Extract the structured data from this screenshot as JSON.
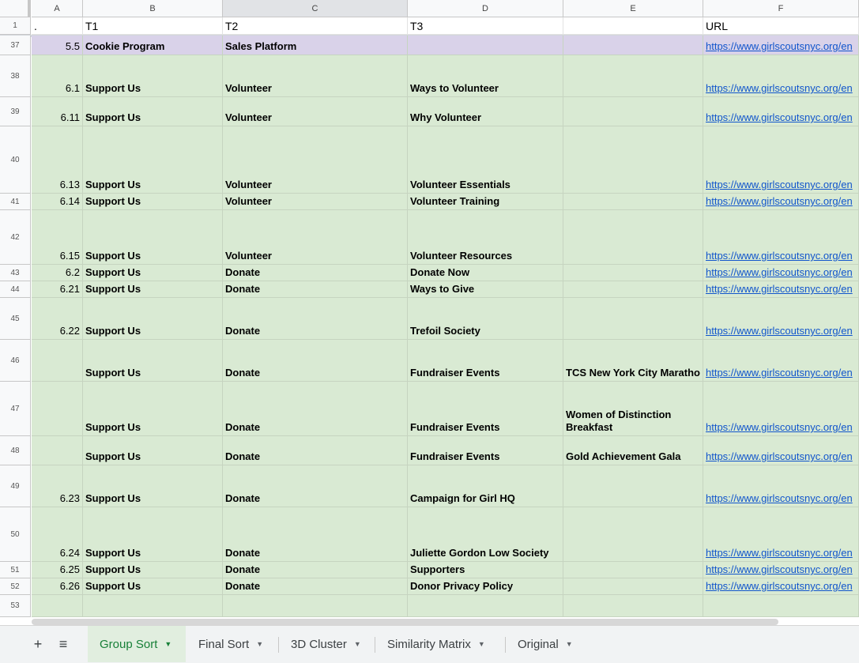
{
  "columns": [
    {
      "letter": "A"
    },
    {
      "letter": "B"
    },
    {
      "letter": "C"
    },
    {
      "letter": "D"
    },
    {
      "letter": "E"
    },
    {
      "letter": "F"
    }
  ],
  "header_row": {
    "num": "1",
    "cells": [
      ".",
      "T1",
      "T2",
      "T3",
      "",
      "URL"
    ]
  },
  "rows": [
    {
      "num": "37",
      "fill": "#d9d2e9",
      "cells": [
        "5.5",
        "Cookie Program",
        "Sales Platform",
        "",
        "",
        "https://www.girlscoutsnyc.org/en"
      ]
    },
    {
      "num": "38",
      "cells": [
        "6.1",
        "Support Us",
        "Volunteer",
        "Ways to Volunteer",
        "",
        "https://www.girlscoutsnyc.org/en"
      ]
    },
    {
      "num": "39",
      "cells": [
        "6.11",
        "Support Us",
        "Volunteer",
        "Why Volunteer",
        "",
        "https://www.girlscoutsnyc.org/en"
      ]
    },
    {
      "num": "40",
      "cells": [
        "6.13",
        "Support Us",
        "Volunteer",
        "Volunteer Essentials",
        "",
        "https://www.girlscoutsnyc.org/en"
      ]
    },
    {
      "num": "41",
      "cells": [
        "6.14",
        "Support Us",
        "Volunteer",
        "Volunteer Training",
        "",
        "https://www.girlscoutsnyc.org/en"
      ]
    },
    {
      "num": "42",
      "cells": [
        "6.15",
        "Support Us",
        "Volunteer",
        "Volunteer Resources",
        "",
        "https://www.girlscoutsnyc.org/en"
      ]
    },
    {
      "num": "43",
      "cells": [
        "6.2",
        "Support Us",
        "Donate",
        "Donate Now",
        "",
        "https://www.girlscoutsnyc.org/en"
      ]
    },
    {
      "num": "44",
      "cells": [
        "6.21",
        "Support Us",
        "Donate",
        "Ways to Give",
        "",
        "https://www.girlscoutsnyc.org/en"
      ]
    },
    {
      "num": "45",
      "cells": [
        "6.22",
        "Support Us",
        "Donate",
        "Trefoil Society",
        "",
        "https://www.girlscoutsnyc.org/en"
      ]
    },
    {
      "num": "46",
      "cells": [
        "",
        "Support Us",
        "Donate",
        "Fundraiser Events",
        "TCS New York City Maratho",
        "https://www.girlscoutsnyc.org/en"
      ]
    },
    {
      "num": "47",
      "cells": [
        "",
        "Support Us",
        "Donate",
        "Fundraiser Events",
        "Women of Distinction Breakfast",
        "https://www.girlscoutsnyc.org/en"
      ]
    },
    {
      "num": "48",
      "cells": [
        "",
        "Support Us",
        "Donate",
        "Fundraiser Events",
        "Gold Achievement Gala",
        "https://www.girlscoutsnyc.org/en"
      ]
    },
    {
      "num": "49",
      "cells": [
        "6.23",
        "Support Us",
        "Donate",
        "Campaign for Girl HQ",
        "",
        "https://www.girlscoutsnyc.org/en"
      ]
    },
    {
      "num": "50",
      "cells": [
        "6.24",
        "Support Us",
        "Donate",
        "Juliette Gordon Low Society",
        "",
        "https://www.girlscoutsnyc.org/en"
      ]
    },
    {
      "num": "51",
      "cells": [
        "6.25",
        "Support Us",
        "Donate",
        "Supporters",
        "",
        "https://www.girlscoutsnyc.org/en"
      ]
    },
    {
      "num": "52",
      "cells": [
        "6.26",
        "Support Us",
        "Donate",
        "Donor Privacy Policy",
        "",
        "https://www.girlscoutsnyc.org/en"
      ]
    },
    {
      "num": "53",
      "cells": [
        "",
        "",
        "",
        "",
        "",
        ""
      ]
    }
  ],
  "tabs": [
    {
      "label": "Group Sort",
      "active": true
    },
    {
      "label": "Final Sort"
    },
    {
      "label": "3D Cluster"
    },
    {
      "label": "Similarity Matrix"
    },
    {
      "label": "Original"
    }
  ],
  "toolbar": {
    "add_icon": "plus-icon",
    "list_icon": "sheet-list-icon"
  },
  "colors": {
    "row_fill": "#d9ead3",
    "highlight_row": "#d9d2e9",
    "link": "#1155cc",
    "active_tab": "#188038"
  }
}
